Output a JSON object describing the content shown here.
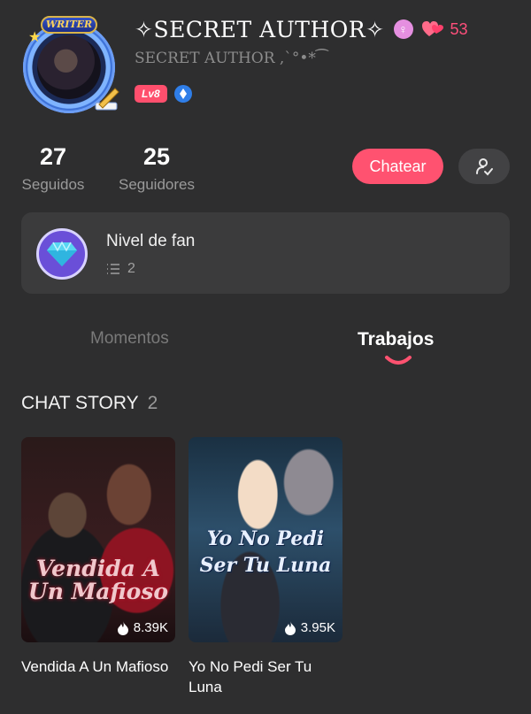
{
  "profile": {
    "avatar_badge": "WRITER",
    "name": "✧SECRET AUTHOR✧",
    "gender_icon": "female-symbol-icon",
    "likes": "53",
    "handle": "SECRET AUTHOR ,`°•*⁀",
    "level_badge": "Lv8",
    "accent_color": "#ff5270"
  },
  "stats": {
    "following": {
      "value": "27",
      "label": "Seguidos"
    },
    "followers": {
      "value": "25",
      "label": "Seguidores"
    }
  },
  "actions": {
    "chat_label": "Chatear",
    "follow_icon": "user-follow-icon"
  },
  "fan_level": {
    "title": "Nivel de fan",
    "count": "2"
  },
  "tabs": [
    {
      "label": "Momentos",
      "active": false
    },
    {
      "label": "Trabajos",
      "active": true
    }
  ],
  "section": {
    "title": "CHAT STORY",
    "count": "2"
  },
  "books": [
    {
      "title": "Vendida A Un Mafioso",
      "cover_text": "Vendida A Un Mafioso",
      "views": "8.39K"
    },
    {
      "title": "Yo No Pedi Ser Tu Luna",
      "cover_text": "Yo No Pedi Ser Tu Luna",
      "views": "3.95K"
    }
  ]
}
